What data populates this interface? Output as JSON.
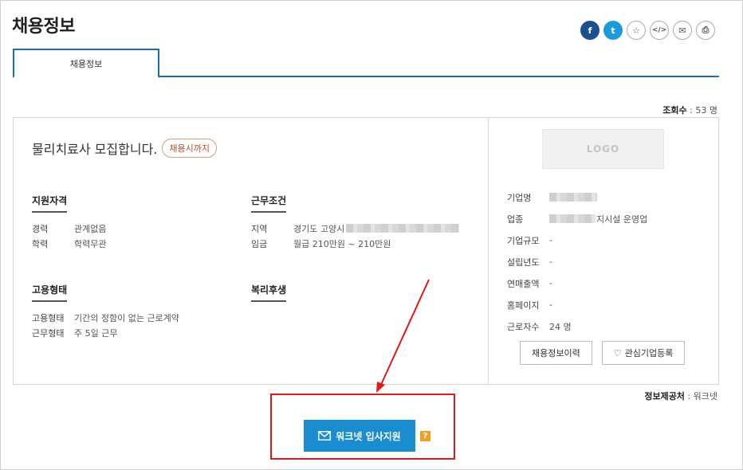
{
  "page": {
    "title": "채용정보"
  },
  "share": {
    "facebook": "f",
    "twitter": "t",
    "favorite": "☆",
    "embed": "</>",
    "email": "✉",
    "print": "⎙"
  },
  "tabs": [
    {
      "label": "채용정보"
    }
  ],
  "views": {
    "label": "조회수",
    "value": " : 53 명"
  },
  "job": {
    "title": "물리치료사 모집합니다.",
    "deadline_badge": "채용시까지"
  },
  "qualifications": {
    "heading": "지원자격",
    "rows": [
      {
        "key": "경력",
        "value": "관계없음"
      },
      {
        "key": "학력",
        "value": "학력무관"
      }
    ]
  },
  "conditions": {
    "heading": "근무조건",
    "rows": [
      {
        "key": "지역",
        "value": "경기도 고양시"
      },
      {
        "key": "임금",
        "value": "월급 210만원 ~ 210만원"
      }
    ]
  },
  "employment": {
    "heading": "고용형태",
    "rows": [
      {
        "key": "고용형태",
        "value": "기간의 정함이 없는 근로계약"
      },
      {
        "key": "근무형태",
        "value": "주 5일 근무"
      }
    ]
  },
  "benefits": {
    "heading": "복리후생"
  },
  "company": {
    "logo_text": "LOGO",
    "rows": [
      {
        "key": "기업명",
        "value": ""
      },
      {
        "key": "업종",
        "value": "지시설 운영업"
      },
      {
        "key": "기업규모",
        "value": "-"
      },
      {
        "key": "설립년도",
        "value": "-"
      },
      {
        "key": "연매출액",
        "value": "-"
      },
      {
        "key": "홈페이지",
        "value": "-"
      },
      {
        "key": "근로자수",
        "value": "24 명"
      }
    ],
    "history_button": "채용정보이력",
    "interest_button": "관심기업등록"
  },
  "source": {
    "label": "정보제공처",
    "value": " : 워크넷"
  },
  "apply": {
    "label": "워크넷 입사지원",
    "help": "?"
  },
  "colors": {
    "accent": "#1a8dd0",
    "tab_border": "#1f6ea8",
    "annotation": "#e01818"
  }
}
